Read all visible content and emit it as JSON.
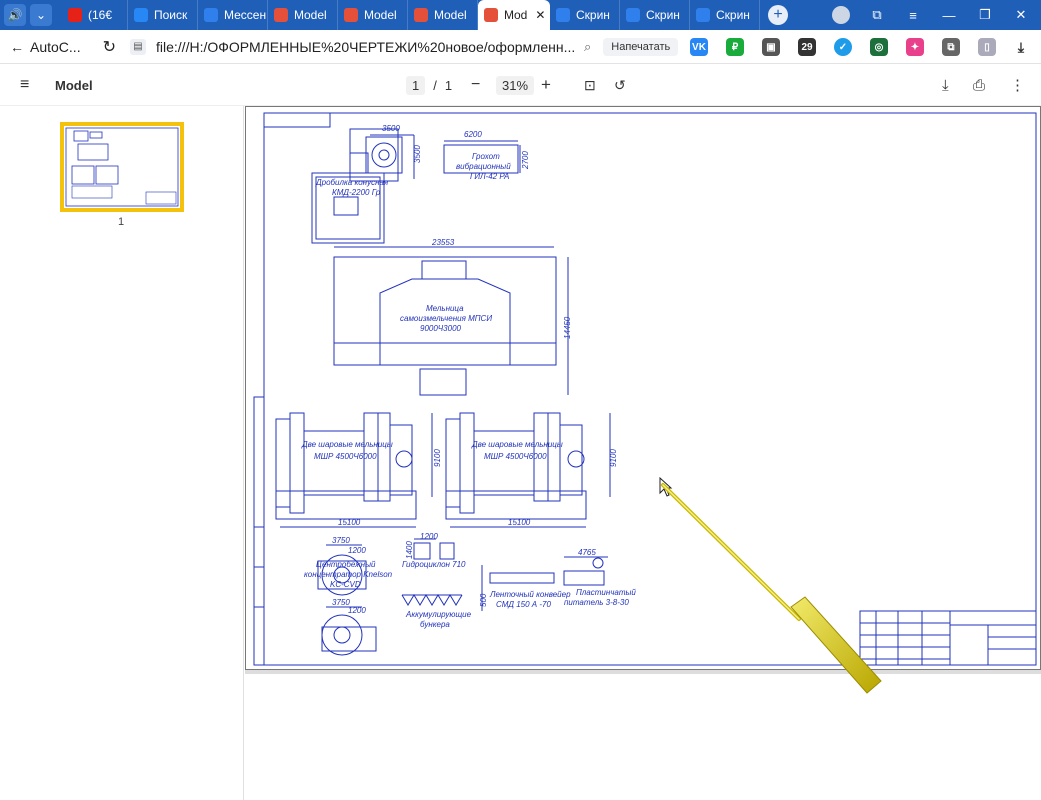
{
  "tabs": [
    {
      "label": "(16€",
      "color": "#e62117",
      "icon": "youtube-icon"
    },
    {
      "label": "Поиск",
      "color": "#2787f5",
      "icon": "vk-icon"
    },
    {
      "label": "Мессен",
      "color": "#2f80ed",
      "icon": "messenger-icon"
    },
    {
      "label": "Model",
      "color": "#e4503a",
      "icon": "pdf-icon"
    },
    {
      "label": "Model",
      "color": "#e4503a",
      "icon": "pdf-icon"
    },
    {
      "label": "Model",
      "color": "#e4503a",
      "icon": "pdf-icon"
    },
    {
      "label": "Mod",
      "color": "#e4503a",
      "icon": "pdf-icon",
      "active": true
    },
    {
      "label": "Скрин",
      "color": "#2f80ed",
      "icon": "screenshot-icon"
    },
    {
      "label": "Скрин",
      "color": "#2f80ed",
      "icon": "screenshot-icon"
    },
    {
      "label": "Скрин",
      "color": "#2f80ed",
      "icon": "screenshot-icon"
    }
  ],
  "address": {
    "back_label": "AutoC...",
    "url": "file:///H:/ОФОРМЛЕННЫЕ%20ЧЕРТЕЖИ%20новое/оформленн...",
    "print_label": "Напечатать",
    "extension_badge": "29"
  },
  "pdf_toolbar": {
    "title": "Model",
    "page_current": "1",
    "page_sep": "/",
    "page_total": "1",
    "zoom": "31%",
    "minus": "−",
    "plus": "+"
  },
  "sidebar": {
    "thumbnail_page_number": "1"
  },
  "drawing": {
    "crusher_label_1": "Дробилка конусная",
    "crusher_label_2": "КМД-2200 Гр",
    "crusher_dim_w": "3500",
    "crusher_dim_h": "3500",
    "screen_dim_w": "6200",
    "screen_dim_h": "2700",
    "screen_label_1": "Грохот",
    "screen_label_2": "вибрационный",
    "screen_label_3": "ГИЛ-42 РА",
    "mill_dim_w": "23553",
    "mill_dim_h": "14450",
    "mill_label_1": "Мельница",
    "mill_label_2": "самоизмельчения МПСИ",
    "mill_label_3": "9000Ч3000",
    "ball_mill_label_1": "Две шаровые мельницы",
    "ball_mill_label_2": "МШР 4500Ч6000",
    "ball_mill_dim_w": "15100",
    "ball_mill_dim_h": "9100",
    "conc_dim_w": "3750",
    "conc_dim_h": "1200",
    "conc_label_1": "Центробежный",
    "conc_label_2": "концентратор Knelson",
    "conc_label_3": "KC-CVD",
    "conc2_dim_w": "3750",
    "conc2_dim_h": "1200",
    "hydro_dim_w": "1200",
    "hydro_dim_h": "1400",
    "hydro_label": "Гидроциклон 710",
    "bunker_label_1": "Аккумулирующие",
    "bunker_label_2": "бункера",
    "conveyor_label_1": "Ленточный конвейер",
    "conveyor_label_2": "СМД 150 А -70",
    "conveyor_dim_h": "500",
    "feeder_dim_w": "4765",
    "feeder_label_1": "Пластинчатый",
    "feeder_label_2": "питатель 3-8-30"
  }
}
